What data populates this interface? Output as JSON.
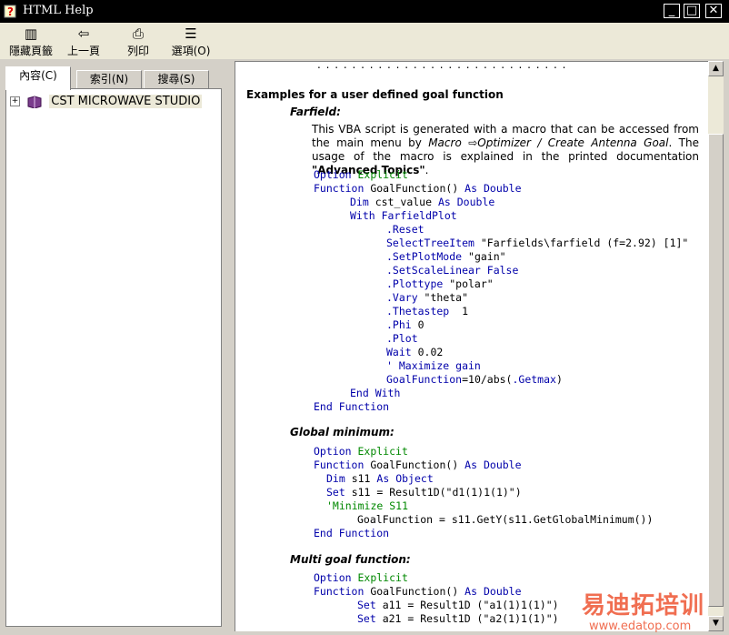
{
  "window": {
    "title": "HTML Help"
  },
  "toolbar": {
    "hide_tabs": "隱藏頁籤",
    "back": "上一頁",
    "print": "列印",
    "options": "選項(O)"
  },
  "nav": {
    "tabs": [
      "內容(C)",
      "索引(N)",
      "搜尋(S)"
    ],
    "tree": [
      {
        "label": "CST MICROWAVE STUDIO"
      }
    ]
  },
  "content": {
    "heading": "Examples for a user defined goal function",
    "farfield": {
      "title": "Farfield:",
      "para_a": "This VBA script is generated with a macro that can be accessed from the main menu by ",
      "macro": "Macro",
      "menu_path": "Optimizer / Create Antenna Goal",
      "para_b": ". The usage of the macro is explained in the printed documentation ",
      "doc": "\"Advanced Topics\"",
      "para_c": ".",
      "code": {
        "l1_kw": "Option",
        "l1_ty": "Explicit",
        "l2_kw": "Function",
        "l2_name": " GoalFunction() ",
        "l2_as": "As",
        "l2_ty": "Double",
        "l3_kw": "Dim",
        "l3_name": " cst_value ",
        "l3_as": "As",
        "l3_ty": "Double",
        "l4": "With FarfieldPlot",
        "l5": ".Reset",
        "l6_a": "SelectTreeItem",
        "l6_b": " \"Farfields\\farfield (f=2.92) [1]\"",
        "l7_a": ".SetPlotMode",
        "l7_b": " \"gain\"",
        "l8": ".SetScaleLinear False",
        "l9_a": ".Plottype",
        "l9_b": " \"polar\"",
        "l10_a": ".Vary",
        "l10_b": " \"theta\"",
        "l11_a": ".Thetastep",
        "l11_b": "  1",
        "l12_a": ".Phi",
        "l12_b": " 0",
        "l13": ".Plot",
        "l14_a": "Wait",
        "l14_b": " 0.02",
        "l15": "' Maximize gain",
        "l16_a": "GoalFunction",
        "l16_b": "=10/abs(",
        "l16_c": ".Getmax",
        "l16_d": ")",
        "l17": "End With",
        "l18": "End Function"
      }
    },
    "global_min": {
      "title": "Global minimum:",
      "code": {
        "l1_kw": "Option",
        "l1_ty": "Explicit",
        "l2_kw": "Function",
        "l2_name": " GoalFunction() ",
        "l2_as": "As",
        "l2_ty": "Double",
        "l3_kw": "Dim",
        "l3_name": " s11 ",
        "l3_as": "As",
        "l3_ty": "Object",
        "l4_kw": "Set",
        "l4_rest": " s11 = Result1D(\"d1(1)1(1)\")",
        "l5": "'Minimize S11",
        "l6": "GoalFunction = s11.GetY(s11.GetGlobalMinimum())",
        "l7": "End Function"
      }
    },
    "multi_goal": {
      "title": "Multi goal function:",
      "code": {
        "l1_kw": "Option",
        "l1_ty": "Explicit",
        "l2_kw": "Function",
        "l2_name": " GoalFunction() ",
        "l2_as": "As",
        "l2_ty": "Double",
        "l3_kw": "Set",
        "l3_rest": " a11 = Result1D (\"a1(1)1(1)\")",
        "l4_kw": "Set",
        "l4_rest": " a21 = Result1D (\"a2(1)1(1)\")"
      }
    },
    "cut_text": ". . . . . . . . . . . . . . . . . . . . . . . . . . . . ."
  },
  "watermark": {
    "brand": "易迪拓培训",
    "url": "www.edatop.com"
  },
  "colors": {
    "keyword": "#0000aa",
    "comment": "#008800",
    "titlebar": "#000000"
  },
  "icons": {
    "app": "help-icon",
    "hide": "hide-tabs-icon",
    "back": "back-arrow-icon",
    "print": "printer-icon",
    "options": "options-icon",
    "book": "book-icon"
  }
}
